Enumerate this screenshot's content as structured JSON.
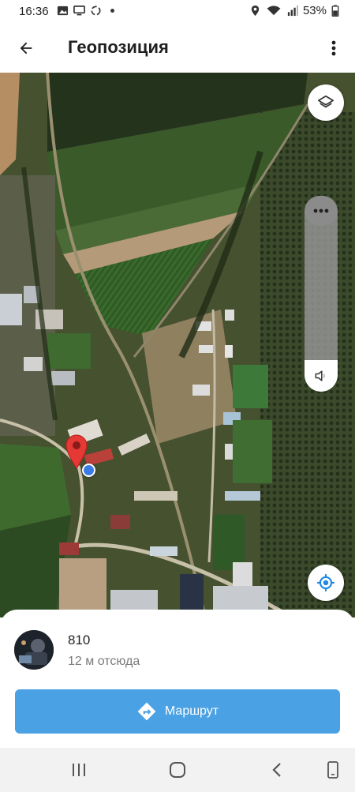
{
  "status_bar": {
    "time": "16:36",
    "battery": "53%",
    "left_icons": [
      "image-icon",
      "monitor-icon",
      "recycle-icon",
      "dot-icon"
    ],
    "right_icons": [
      "location-icon",
      "wifi-icon",
      "signal-icon",
      "battery-icon"
    ]
  },
  "app_bar": {
    "title": "Геопозиция",
    "back_icon": "arrow-left-icon",
    "menu_icon": "more-vert-icon"
  },
  "map": {
    "layers_icon": "layers-icon",
    "locate_icon": "my-location-icon",
    "slider_handle_icon": "more-horiz-icon",
    "slider_bottom_icon": "volume-icon",
    "pin_color": "#e53935",
    "me_dot_color": "#3b7be5"
  },
  "contact": {
    "name": "810",
    "distance": "12 м отсюда"
  },
  "route_button": {
    "label": "Маршрут",
    "icon": "directions-icon",
    "color": "#4aa1e3"
  },
  "nav_bar": {
    "icons": [
      "recent-apps-icon",
      "home-icon",
      "back-icon",
      "accessibility-icon"
    ]
  }
}
